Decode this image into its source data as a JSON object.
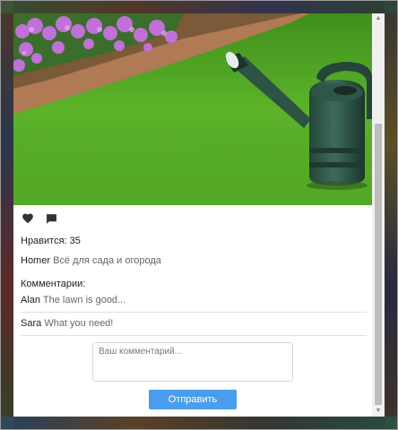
{
  "post": {
    "image_alt": "Лейка на газоне",
    "likes_text": "Нравится: 35",
    "author": "Homer",
    "caption": "Всё для сада и огорода"
  },
  "icons": {
    "like": "heart-icon",
    "comment": "speech-bubble-icon"
  },
  "comments": {
    "label": "Комментарии:",
    "items": [
      {
        "author": "Alan",
        "text": "The lawn is good..."
      },
      {
        "author": "Sara",
        "text": "What you need!"
      }
    ]
  },
  "form": {
    "placeholder": "Ваш комментарий...",
    "value": "",
    "submit_label": "Отправить"
  },
  "scrollbar": {
    "up_glyph": "▲",
    "down_glyph": "▼",
    "position_fraction": 0.35
  },
  "colors": {
    "accent": "#4a9ded",
    "icon": "#333333"
  }
}
